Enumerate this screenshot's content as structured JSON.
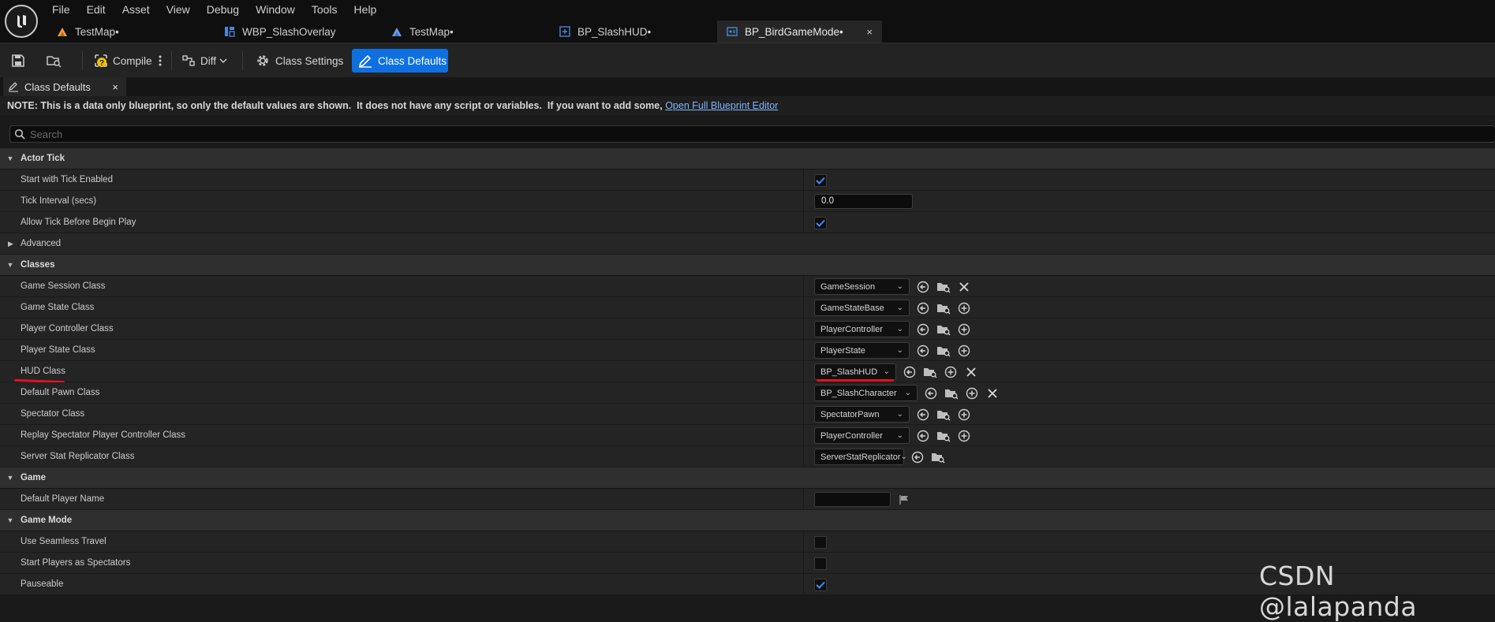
{
  "menu": [
    "File",
    "Edit",
    "Asset",
    "View",
    "Debug",
    "Window",
    "Tools",
    "Help"
  ],
  "tabs": [
    {
      "label": "TestMap•"
    },
    {
      "label": "WBP_SlashOverlay"
    },
    {
      "label": "TestMap•"
    },
    {
      "label": "BP_SlashHUD•"
    },
    {
      "label": "BP_BirdGameMode•",
      "close": "×"
    }
  ],
  "toolbar": {
    "compile_label": "Compile",
    "diff_label": "Diff",
    "class_settings_label": "Class Settings",
    "class_defaults_label": "Class Defaults"
  },
  "panel_tab": {
    "label": "Class Defaults",
    "close": "×"
  },
  "note": {
    "text": "NOTE: This is a data only blueprint, so only the default values are shown.  It does not have any script or variables.  If you want to add some, ",
    "link": "Open Full Blueprint Editor"
  },
  "search": {
    "placeholder": "Search"
  },
  "categories": {
    "actor_tick": "Actor Tick",
    "advanced": "Advanced",
    "classes": "Classes",
    "game": "Game",
    "game_mode": "Game Mode"
  },
  "props": {
    "start_tick": "Start with Tick Enabled",
    "tick_interval": "Tick Interval (secs)",
    "tick_interval_value": "0.0",
    "allow_tick": "Allow Tick Before Begin Play",
    "game_session": "Game Session Class",
    "game_session_value": "GameSession",
    "game_state": "Game State Class",
    "game_state_value": "GameStateBase",
    "player_controller": "Player Controller Class",
    "player_controller_value": "PlayerController",
    "player_state": "Player State Class",
    "player_state_value": "PlayerState",
    "hud": "HUD Class",
    "hud_value": "BP_SlashHUD",
    "default_pawn": "Default Pawn Class",
    "default_pawn_value": "BP_SlashCharacter",
    "spectator": "Spectator Class",
    "spectator_value": "SpectatorPawn",
    "replay_spectator": "Replay Spectator Player Controller Class",
    "replay_spectator_value": "PlayerController",
    "server_stat": "Server Stat Replicator Class",
    "server_stat_value": "ServerStatReplicator",
    "default_player_name": "Default Player Name",
    "seamless": "Use Seamless Travel",
    "start_spectators": "Start Players as Spectators",
    "pauseable": "Pauseable"
  },
  "watermark": "CSDN @lalapanda",
  "colors": {
    "accent": "#0e70e0",
    "check": "#3d8bff",
    "annotation": "#e0141c"
  }
}
